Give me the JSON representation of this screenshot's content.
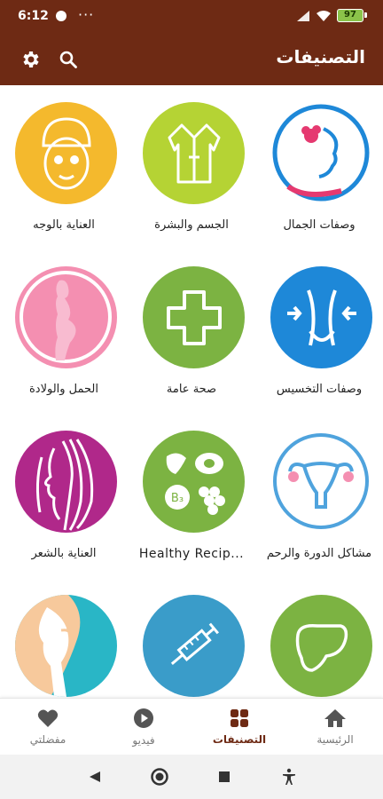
{
  "status_bar": {
    "time": "6:12",
    "more": "···",
    "battery": "97"
  },
  "app_bar": {
    "title": "التصنيفات",
    "settings_icon": "gear-icon",
    "search_icon": "search-icon"
  },
  "categories": [
    {
      "label": "وصفات الجمال",
      "icon": "beauty-face-flower-icon",
      "color": "#ffffff"
    },
    {
      "label": "الجسم والبشرة",
      "icon": "bathrobe-icon",
      "color": "#b5d334"
    },
    {
      "label": "العناية بالوجه",
      "icon": "face-mask-icon",
      "color": "#f4b92d"
    },
    {
      "label": "وصفات التخسيس",
      "icon": "slim-waist-icon",
      "color": "#1e88d8"
    },
    {
      "label": "صحة عامة",
      "icon": "medical-cross-icon",
      "color": "#7cb342"
    },
    {
      "label": "الحمل والولادة",
      "icon": "pregnancy-icon",
      "color": "#f48fb1"
    },
    {
      "label": "مشاكل الدورة والرحم",
      "icon": "uterus-icon",
      "color": "#ffffff"
    },
    {
      "label": "Healthy Recip...",
      "icon": "healthy-food-icon",
      "color": "#7cb342"
    },
    {
      "label": "العناية بالشعر",
      "icon": "hair-profile-icon",
      "color": "#b0288a"
    },
    {
      "label": "",
      "icon": "liver-icon",
      "color": "#7cb342"
    },
    {
      "label": "",
      "icon": "syringe-icon",
      "color": "#3a9cc9"
    },
    {
      "label": "",
      "icon": "knee-joint-icon",
      "color": "#29b6c6"
    }
  ],
  "bottom_nav": [
    {
      "label": "الرئيسية",
      "icon": "home-icon"
    },
    {
      "label": "التصنيفات",
      "icon": "categories-grid-icon",
      "active": true
    },
    {
      "label": "فيديو",
      "icon": "play-icon"
    },
    {
      "label": "مفضلتي",
      "icon": "heart-icon"
    }
  ],
  "colors": {
    "primary": "#6e2a14",
    "active": "#6e2a14",
    "inactive": "#555555"
  }
}
